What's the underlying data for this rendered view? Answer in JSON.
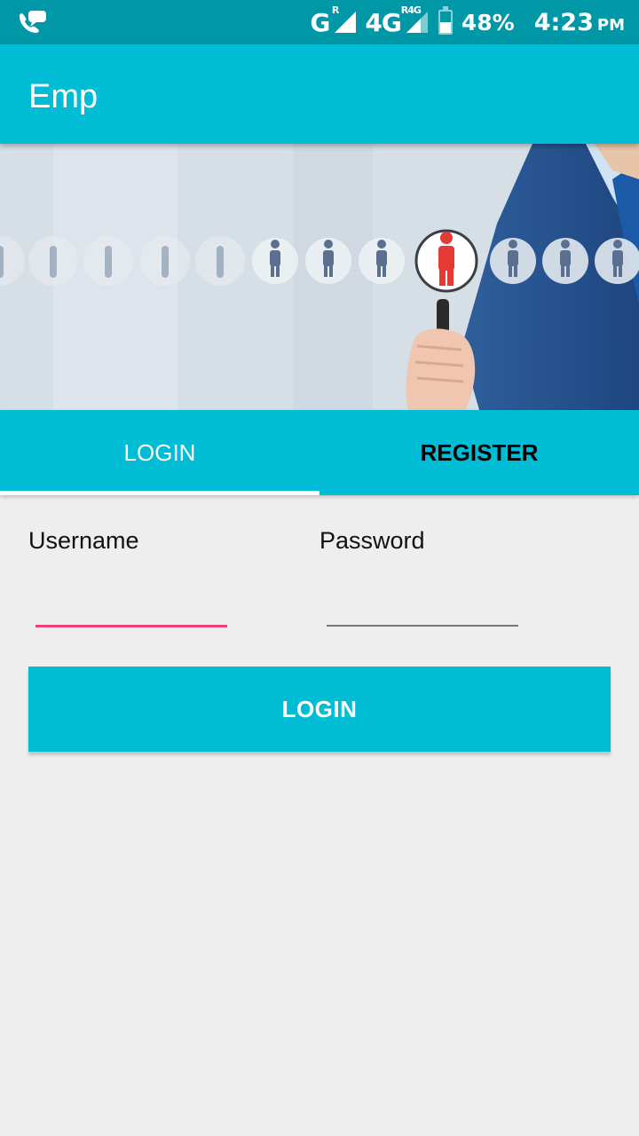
{
  "status_bar": {
    "left_icon": "phone-chat-icon",
    "network_1": "G",
    "network_1_sup": "R",
    "network_2": "4G",
    "network_2_sup": "R4G",
    "battery_percent": "48%",
    "battery_level": 0.48,
    "time": "4:23",
    "ampm": "PM"
  },
  "app_bar": {
    "title": "Emp"
  },
  "banner": {
    "image": "recruitment-search-illustration",
    "highlight_color": "#e53935"
  },
  "tabs": [
    {
      "label": "LOGIN",
      "selected": true
    },
    {
      "label": "REGISTER",
      "selected": false
    }
  ],
  "form": {
    "username_label": "Username",
    "username_value": "",
    "password_label": "Password",
    "password_value": "",
    "submit_label": "LOGIN"
  },
  "colors": {
    "primary": "#00bcd4",
    "primary_dark": "#0097a7",
    "accent": "#ec407a",
    "background": "#eeeeee"
  }
}
